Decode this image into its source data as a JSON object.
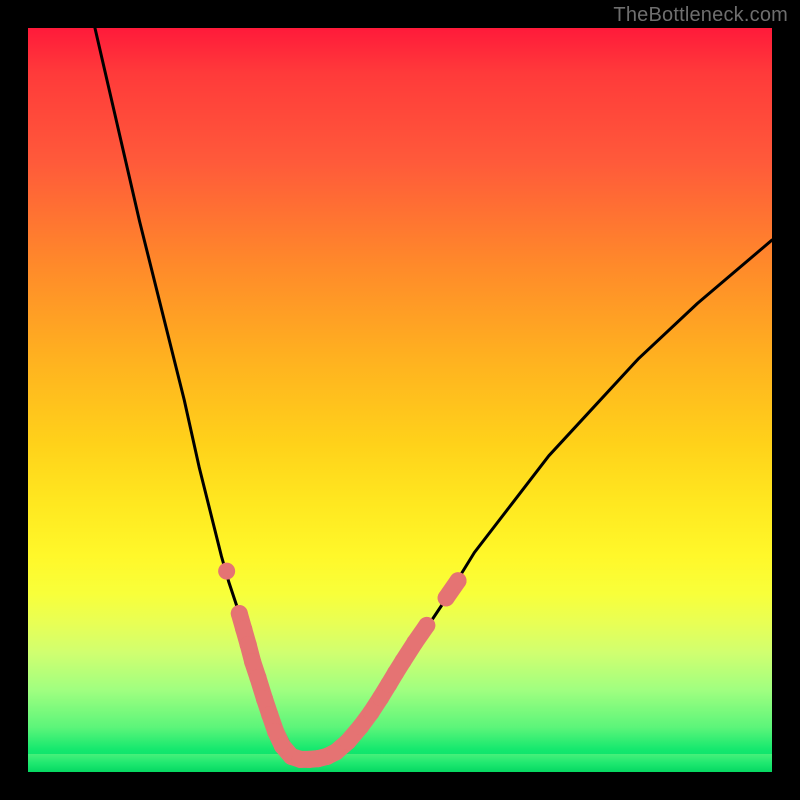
{
  "attribution": "TheBottleneck.com",
  "colors": {
    "frame": "#000000",
    "curve_stroke": "#000000",
    "marker_fill": "#e57373",
    "marker_stroke": "#d86a6a",
    "gradient_top": "#ff1a3a",
    "gradient_bottom": "#00d868"
  },
  "chart_data": {
    "type": "line",
    "title": "",
    "xlabel": "",
    "ylabel": "",
    "xlim": [
      0,
      100
    ],
    "ylim": [
      0,
      100
    ],
    "series": [
      {
        "name": "bottleneck-curve-left",
        "x": [
          9,
          12,
          15,
          18,
          21,
          23,
          25,
          26,
          27,
          28,
          29,
          30,
          31,
          32,
          33,
          34,
          35,
          36
        ],
        "y": [
          100,
          87,
          74,
          62,
          50,
          41,
          33,
          29,
          25.5,
          22.5,
          19.5,
          16.5,
          13.5,
          11,
          8.5,
          6,
          4,
          2.2
        ]
      },
      {
        "name": "bottleneck-curve-right",
        "x": [
          36,
          38,
          40,
          42,
          44,
          46,
          48,
          50,
          53,
          56,
          60,
          65,
          70,
          76,
          82,
          90,
          100
        ],
        "y": [
          2.2,
          2.0,
          2.2,
          3.2,
          5.0,
          7.6,
          10.8,
          14.0,
          18.5,
          23.0,
          29.5,
          36.0,
          42.5,
          49.0,
          55.5,
          63.0,
          71.5
        ]
      }
    ],
    "markers": {
      "name": "highlighted-points",
      "style": "pill",
      "color": "#e57373",
      "points": [
        {
          "x": 26.7,
          "y": 27.0
        },
        {
          "x": 28.4,
          "y": 21.3
        },
        {
          "x": 29.0,
          "y": 19.2
        },
        {
          "x": 29.6,
          "y": 17.1
        },
        {
          "x": 30.2,
          "y": 14.8
        },
        {
          "x": 30.9,
          "y": 12.7
        },
        {
          "x": 31.8,
          "y": 9.8
        },
        {
          "x": 32.5,
          "y": 7.7
        },
        {
          "x": 33.3,
          "y": 5.4
        },
        {
          "x": 34.2,
          "y": 3.5
        },
        {
          "x": 35.4,
          "y": 2.1
        },
        {
          "x": 36.6,
          "y": 1.7
        },
        {
          "x": 37.8,
          "y": 1.7
        },
        {
          "x": 39.0,
          "y": 1.8
        },
        {
          "x": 40.2,
          "y": 2.1
        },
        {
          "x": 41.4,
          "y": 2.7
        },
        {
          "x": 43.0,
          "y": 4.1
        },
        {
          "x": 44.7,
          "y": 6.1
        },
        {
          "x": 46.1,
          "y": 8.0
        },
        {
          "x": 47.4,
          "y": 10.0
        },
        {
          "x": 48.5,
          "y": 11.8
        },
        {
          "x": 49.4,
          "y": 13.3
        },
        {
          "x": 50.4,
          "y": 14.9
        },
        {
          "x": 52.0,
          "y": 17.4
        },
        {
          "x": 53.6,
          "y": 19.7
        },
        {
          "x": 56.2,
          "y": 23.4
        },
        {
          "x": 57.8,
          "y": 25.7
        }
      ]
    }
  }
}
